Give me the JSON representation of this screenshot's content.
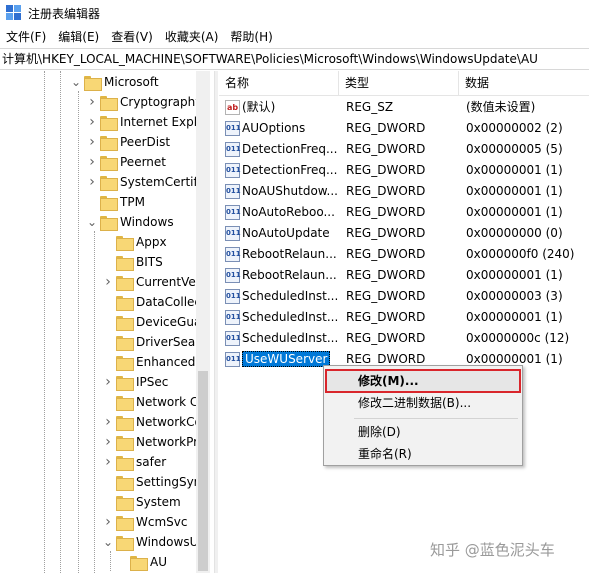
{
  "window": {
    "title": "注册表编辑器"
  },
  "menubar": [
    "文件(F)",
    "编辑(E)",
    "查看(V)",
    "收藏夹(A)",
    "帮助(H)"
  ],
  "address": "计算机\\HKEY_LOCAL_MACHINE\\SOFTWARE\\Policies\\Microsoft\\Windows\\WindowsUpdate\\AU",
  "tree": [
    {
      "label": "Microsoft",
      "expander": "expanded"
    },
    {
      "label": "Cryptography",
      "expander": "collapsed"
    },
    {
      "label": "Internet Explo",
      "expander": "collapsed"
    },
    {
      "label": "PeerDist",
      "expander": "collapsed"
    },
    {
      "label": "Peernet",
      "expander": "collapsed"
    },
    {
      "label": "SystemCertific",
      "expander": "collapsed"
    },
    {
      "label": "TPM",
      "expander": "none"
    },
    {
      "label": "Windows",
      "expander": "expanded"
    },
    {
      "label": "Appx",
      "expander": "none"
    },
    {
      "label": "BITS",
      "expander": "none"
    },
    {
      "label": "CurrentVer",
      "expander": "collapsed"
    },
    {
      "label": "DataCollec",
      "expander": "none"
    },
    {
      "label": "DeviceGua",
      "expander": "none"
    },
    {
      "label": "DriverSear",
      "expander": "none"
    },
    {
      "label": "EnhancedS",
      "expander": "none"
    },
    {
      "label": "IPSec",
      "expander": "collapsed"
    },
    {
      "label": "Network C",
      "expander": "none"
    },
    {
      "label": "NetworkCo",
      "expander": "collapsed"
    },
    {
      "label": "NetworkPr",
      "expander": "collapsed"
    },
    {
      "label": "safer",
      "expander": "collapsed"
    },
    {
      "label": "SettingSyn",
      "expander": "none"
    },
    {
      "label": "System",
      "expander": "none"
    },
    {
      "label": "WcmSvc",
      "expander": "collapsed"
    },
    {
      "label": "WindowsU",
      "expander": "expanded"
    },
    {
      "label": "AU",
      "expander": "none"
    }
  ],
  "list": {
    "headers": {
      "name": "名称",
      "type": "类型",
      "data": "数据"
    },
    "rows": [
      {
        "name": "(默认)",
        "type": "REG_SZ",
        "data": "(数值未设置)",
        "icon": "string-value-icon",
        "icon_text": "ab"
      },
      {
        "name": "AUOptions",
        "type": "REG_DWORD",
        "data": "0x00000002 (2)",
        "icon": "dword-value-icon",
        "icon_text": "011"
      },
      {
        "name": "DetectionFreq...",
        "type": "REG_DWORD",
        "data": "0x00000005 (5)",
        "icon": "dword-value-icon",
        "icon_text": "011"
      },
      {
        "name": "DetectionFreq...",
        "type": "REG_DWORD",
        "data": "0x00000001 (1)",
        "icon": "dword-value-icon",
        "icon_text": "011"
      },
      {
        "name": "NoAUShutdow...",
        "type": "REG_DWORD",
        "data": "0x00000001 (1)",
        "icon": "dword-value-icon",
        "icon_text": "011"
      },
      {
        "name": "NoAutoReboo...",
        "type": "REG_DWORD",
        "data": "0x00000001 (1)",
        "icon": "dword-value-icon",
        "icon_text": "011"
      },
      {
        "name": "NoAutoUpdate",
        "type": "REG_DWORD",
        "data": "0x00000000 (0)",
        "icon": "dword-value-icon",
        "icon_text": "011"
      },
      {
        "name": "RebootRelaun...",
        "type": "REG_DWORD",
        "data": "0x000000f0 (240)",
        "icon": "dword-value-icon",
        "icon_text": "011"
      },
      {
        "name": "RebootRelaun...",
        "type": "REG_DWORD",
        "data": "0x00000001 (1)",
        "icon": "dword-value-icon",
        "icon_text": "011"
      },
      {
        "name": "ScheduledInst...",
        "type": "REG_DWORD",
        "data": "0x00000003 (3)",
        "icon": "dword-value-icon",
        "icon_text": "011"
      },
      {
        "name": "ScheduledInst...",
        "type": "REG_DWORD",
        "data": "0x00000001 (1)",
        "icon": "dword-value-icon",
        "icon_text": "011"
      },
      {
        "name": "ScheduledInst...",
        "type": "REG_DWORD",
        "data": "0x0000000c (12)",
        "icon": "dword-value-icon",
        "icon_text": "011"
      },
      {
        "name": "UseWUServer",
        "type": "REG_DWORD",
        "data": "0x00000001 (1)",
        "icon": "dword-value-icon",
        "icon_text": "011",
        "selected": true
      }
    ]
  },
  "context_menu": [
    {
      "label": "修改(M)...",
      "highlighted": true
    },
    {
      "label": "修改二进制数据(B)..."
    },
    {
      "label": "删除(D)"
    },
    {
      "label": "重命名(R)"
    }
  ],
  "watermark": "知乎 @蓝色泥头车",
  "colors": {
    "selection": "#0078d7",
    "highlight_border": "#d9262c",
    "folder": "#f8d775"
  }
}
